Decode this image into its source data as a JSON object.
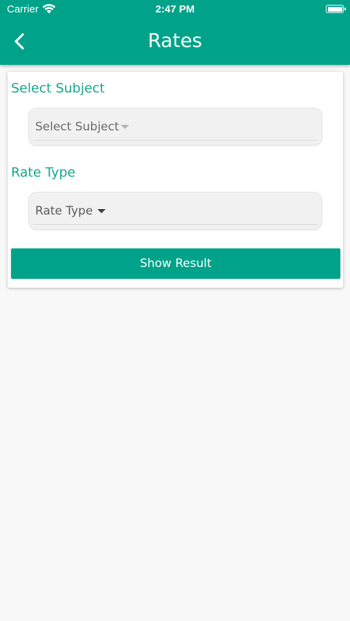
{
  "status_bar": {
    "carrier": "Carrier",
    "time": "2:47 PM",
    "wifi_icon": "wifi-icon",
    "battery_icon": "battery-icon"
  },
  "header": {
    "title": "Rates",
    "back_icon": "chevron-left-icon",
    "background_color": "#00a38a"
  },
  "form": {
    "subject_label": "Select Subject",
    "subject_value": "Select Subject",
    "rate_type_label": "Rate Type",
    "rate_type_value": "Rate Type",
    "submit_label": "Show Result",
    "label_color": "#17a68e"
  }
}
